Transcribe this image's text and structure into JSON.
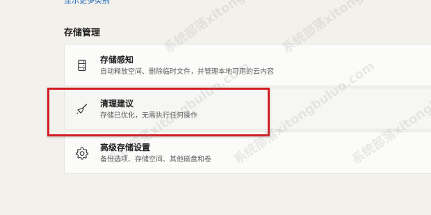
{
  "top_link": "显示更多类别",
  "section_title": "存储管理",
  "cards": [
    {
      "title": "存储感知",
      "description": "自动释放空间、删除临时文件，并管理本地可用的云内容",
      "icon": "drive-icon"
    },
    {
      "title": "清理建议",
      "description": "存储已优化，无需执行任何操作",
      "icon": "broom-icon"
    },
    {
      "title": "高级存储设置",
      "description": "备份选项、存储空间、其他磁盘和卷",
      "icon": "gear-icon"
    }
  ],
  "highlight_color": "#d41e24",
  "link_color": "#0f5fb3",
  "watermark": "系统部落xitongbuluo.com"
}
